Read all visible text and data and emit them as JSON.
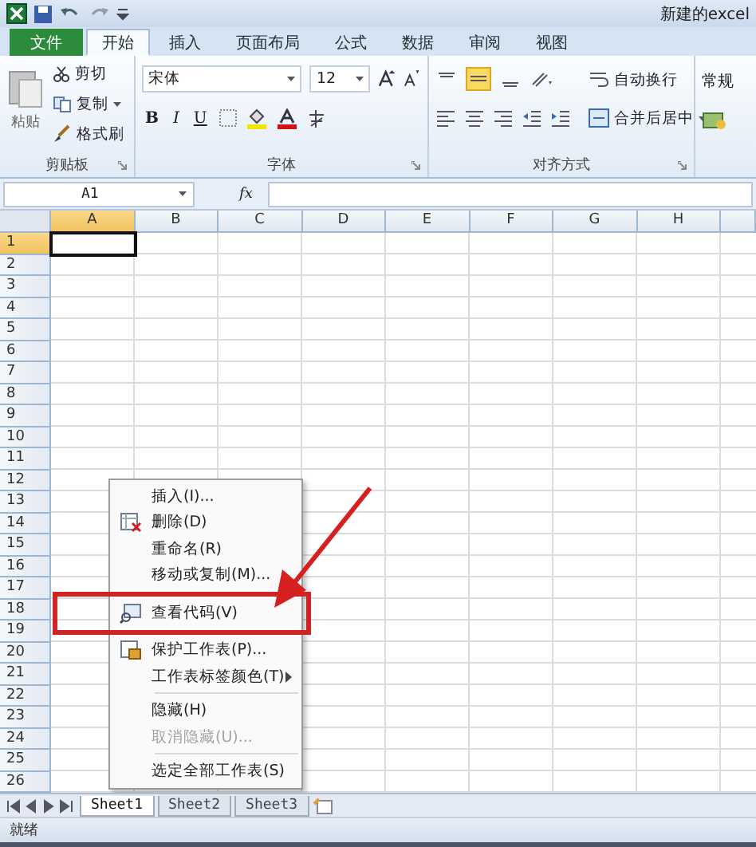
{
  "title_bar": {
    "title": "新建的excel"
  },
  "ribbon_tabs": [
    {
      "label": "文件",
      "kind": "file",
      "selected": false
    },
    {
      "label": "开始",
      "kind": "tab",
      "selected": true
    },
    {
      "label": "插入",
      "kind": "tab",
      "selected": false
    },
    {
      "label": "页面布局",
      "kind": "tab",
      "selected": false
    },
    {
      "label": "公式",
      "kind": "tab",
      "selected": false
    },
    {
      "label": "数据",
      "kind": "tab",
      "selected": false
    },
    {
      "label": "审阅",
      "kind": "tab",
      "selected": false
    },
    {
      "label": "视图",
      "kind": "tab",
      "selected": false
    }
  ],
  "ribbon": {
    "clipboard": {
      "paste": "粘贴",
      "cut": "剪切",
      "copy": "复制",
      "format_painter": "格式刷",
      "group_label": "剪贴板"
    },
    "font": {
      "name": "宋体",
      "size": "12",
      "bold": "B",
      "italic": "I",
      "underline": "U",
      "group_label": "字体"
    },
    "alignment": {
      "wrap": "自动换行",
      "merge": "合并后居中",
      "group_label": "对齐方式"
    },
    "number": {
      "format": "常规"
    }
  },
  "formula_bar": {
    "cell_ref": "A1",
    "fx": "fx"
  },
  "grid": {
    "columns": [
      {
        "label": "A",
        "selected": true
      },
      {
        "label": "B",
        "selected": false
      },
      {
        "label": "C",
        "selected": false
      },
      {
        "label": "D",
        "selected": false
      },
      {
        "label": "E",
        "selected": false
      },
      {
        "label": "F",
        "selected": false
      },
      {
        "label": "G",
        "selected": false
      },
      {
        "label": "H",
        "selected": false
      }
    ],
    "rows": [
      {
        "label": "1",
        "selected": true
      },
      {
        "label": "2",
        "selected": false
      },
      {
        "label": "3",
        "selected": false
      },
      {
        "label": "4",
        "selected": false
      },
      {
        "label": "5",
        "selected": false
      },
      {
        "label": "6",
        "selected": false
      },
      {
        "label": "7",
        "selected": false
      },
      {
        "label": "8",
        "selected": false
      },
      {
        "label": "9",
        "selected": false
      },
      {
        "label": "10",
        "selected": false
      },
      {
        "label": "11",
        "selected": false
      },
      {
        "label": "12",
        "selected": false
      },
      {
        "label": "13",
        "selected": false
      },
      {
        "label": "14",
        "selected": false
      },
      {
        "label": "15",
        "selected": false
      },
      {
        "label": "16",
        "selected": false
      },
      {
        "label": "17",
        "selected": false
      },
      {
        "label": "18",
        "selected": false
      },
      {
        "label": "19",
        "selected": false
      },
      {
        "label": "20",
        "selected": false
      },
      {
        "label": "21",
        "selected": false
      },
      {
        "label": "22",
        "selected": false
      },
      {
        "label": "23",
        "selected": false
      },
      {
        "label": "24",
        "selected": false
      },
      {
        "label": "25",
        "selected": false
      },
      {
        "label": "26",
        "selected": false
      }
    ]
  },
  "context_menu": {
    "items": [
      {
        "label": "插入(I)...",
        "kind": "plain",
        "disabled": false,
        "submenu": false,
        "separator_before": false
      },
      {
        "label": "删除(D)",
        "kind": "delete",
        "disabled": false,
        "submenu": false,
        "separator_before": false
      },
      {
        "label": "重命名(R)",
        "kind": "plain",
        "disabled": false,
        "submenu": false,
        "separator_before": false
      },
      {
        "label": "移动或复制(M)...",
        "kind": "plain",
        "disabled": false,
        "submenu": false,
        "separator_before": false
      },
      {
        "label": "查看代码(V)",
        "kind": "code",
        "disabled": false,
        "submenu": false,
        "separator_before": false,
        "highlighted": true
      },
      {
        "label": "保护工作表(P)...",
        "kind": "protect",
        "disabled": false,
        "submenu": false,
        "separator_before": false
      },
      {
        "label": "工作表标签颜色(T)",
        "kind": "plain",
        "disabled": false,
        "submenu": true,
        "separator_before": false
      },
      {
        "label": "隐藏(H)",
        "kind": "plain",
        "disabled": false,
        "submenu": false,
        "separator_before": true
      },
      {
        "label": "取消隐藏(U)...",
        "kind": "plain",
        "disabled": true,
        "submenu": false,
        "separator_before": false
      },
      {
        "label": "选定全部工作表(S)",
        "kind": "plain",
        "disabled": false,
        "submenu": false,
        "separator_before": true
      }
    ]
  },
  "sheet_tabs": [
    {
      "label": "Sheet1",
      "selected": true
    },
    {
      "label": "Sheet2",
      "selected": false
    },
    {
      "label": "Sheet3",
      "selected": false
    }
  ],
  "status_bar": {
    "text": "就绪"
  }
}
